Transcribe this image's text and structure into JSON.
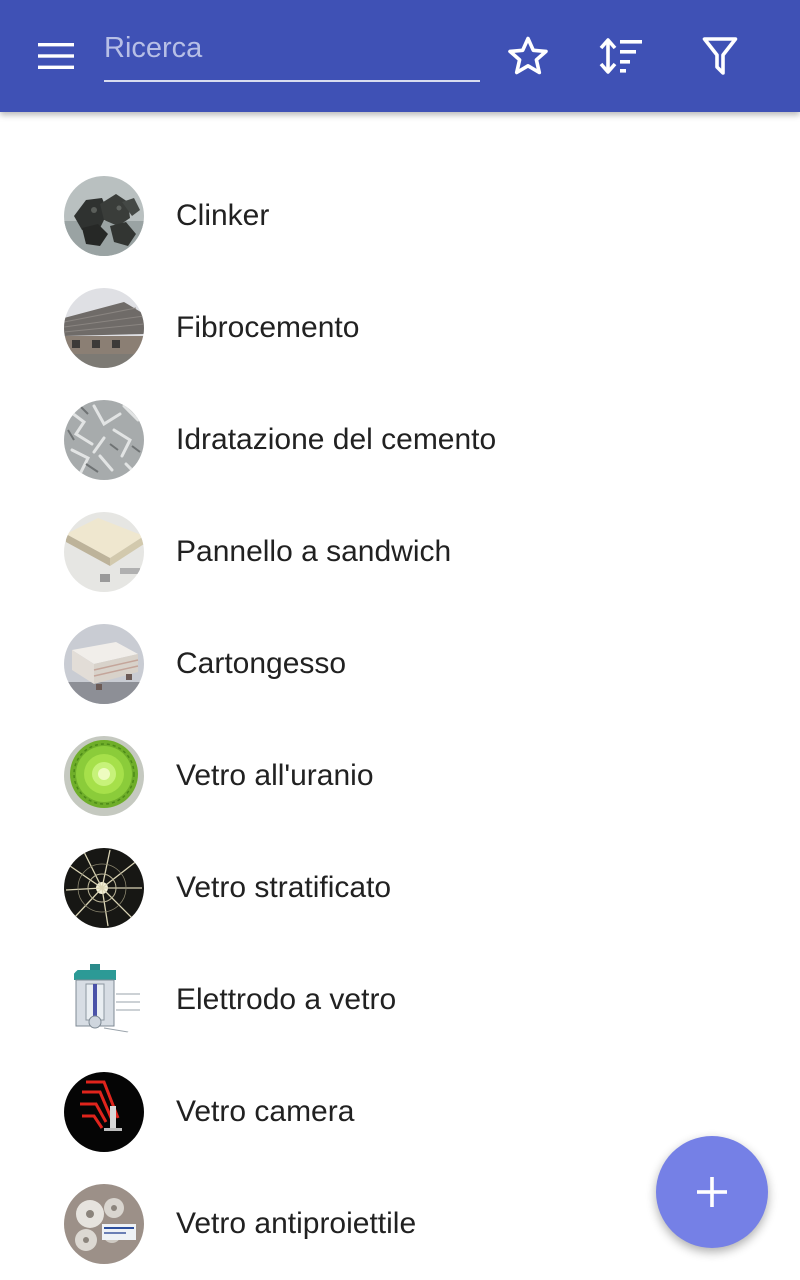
{
  "header": {
    "menu_icon": "hamburger-menu-icon",
    "search_placeholder": "Ricerca",
    "search_value": "",
    "actions": [
      {
        "name": "favorites",
        "icon": "star-outline-icon"
      },
      {
        "name": "sort",
        "icon": "sort-icon"
      },
      {
        "name": "filter",
        "icon": "filter-icon"
      }
    ],
    "bar_color": "#3f51b5"
  },
  "list": {
    "items": [
      {
        "label": "Clinker",
        "thumbnail": "clinker"
      },
      {
        "label": "Fibrocemento",
        "thumbnail": "fibrocemento"
      },
      {
        "label": "Idratazione del cemento",
        "thumbnail": "idratazione"
      },
      {
        "label": "Pannello a sandwich",
        "thumbnail": "sandwich-panel"
      },
      {
        "label": "Cartongesso",
        "thumbnail": "cartongesso"
      },
      {
        "label": "Vetro all'uranio",
        "thumbnail": "uranium-glass"
      },
      {
        "label": "Vetro stratificato",
        "thumbnail": "laminated-glass"
      },
      {
        "label": "Elettrodo a vetro",
        "thumbnail": "glass-electrode"
      },
      {
        "label": "Vetro camera",
        "thumbnail": "insulated-glass"
      },
      {
        "label": "Vetro antiproiettile",
        "thumbnail": "bulletproof-glass"
      }
    ]
  },
  "fab": {
    "icon": "plus-icon",
    "color": "#7580e6"
  }
}
